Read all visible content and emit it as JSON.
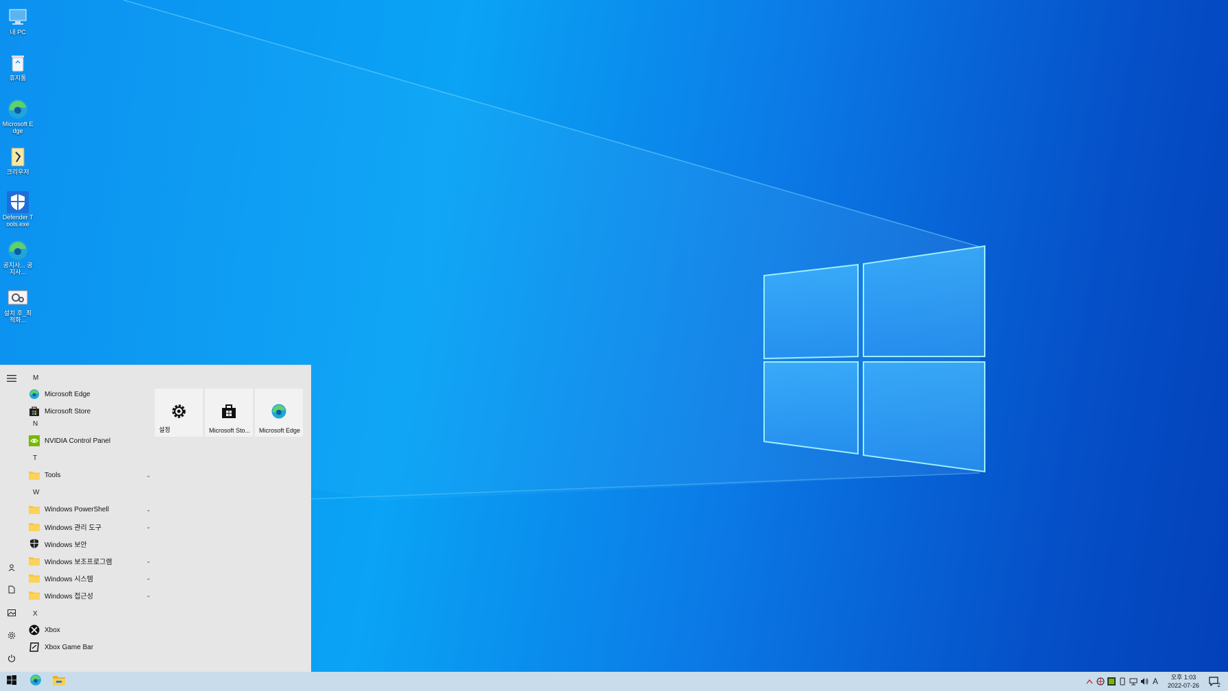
{
  "desktop": {
    "icons": [
      {
        "label": "내 PC",
        "icon": "computer-icon"
      },
      {
        "label": "휴지통",
        "icon": "recycle-bin-icon"
      },
      {
        "label": "Microsoft Edge",
        "icon": "edge-icon"
      },
      {
        "label": "크리우저",
        "icon": "shortcut-icon"
      },
      {
        "label": "Defender Tools.exe",
        "icon": "shield-icon"
      },
      {
        "label": "공지사... 공지사...",
        "icon": "edge-icon"
      },
      {
        "label": "설치 후_최적화...",
        "icon": "settings-tool-icon"
      }
    ]
  },
  "start_menu": {
    "letters": {
      "m": "M",
      "n": "N",
      "t": "T",
      "w": "W",
      "x": "X"
    },
    "apps": {
      "edge": "Microsoft Edge",
      "store": "Microsoft Store",
      "nvidia": "NVIDIA Control Panel",
      "tools": "Tools",
      "powershell": "Windows PowerShell",
      "admin_tools": "Windows 관리 도구",
      "security": "Windows 보안",
      "accessories": "Windows 보조프로그램",
      "system": "Windows 시스템",
      "accessibility": "Windows 접근성",
      "xbox": "Xbox",
      "xbox_game_bar": "Xbox Game Bar"
    },
    "tiles": {
      "settings": "설정",
      "store": "Microsoft Sto...",
      "edge": "Microsoft Edge"
    }
  },
  "taskbar": {
    "clock_time": "오후 1:03",
    "clock_date": "2022-07-26",
    "ime": "A",
    "notification_count": "2"
  }
}
